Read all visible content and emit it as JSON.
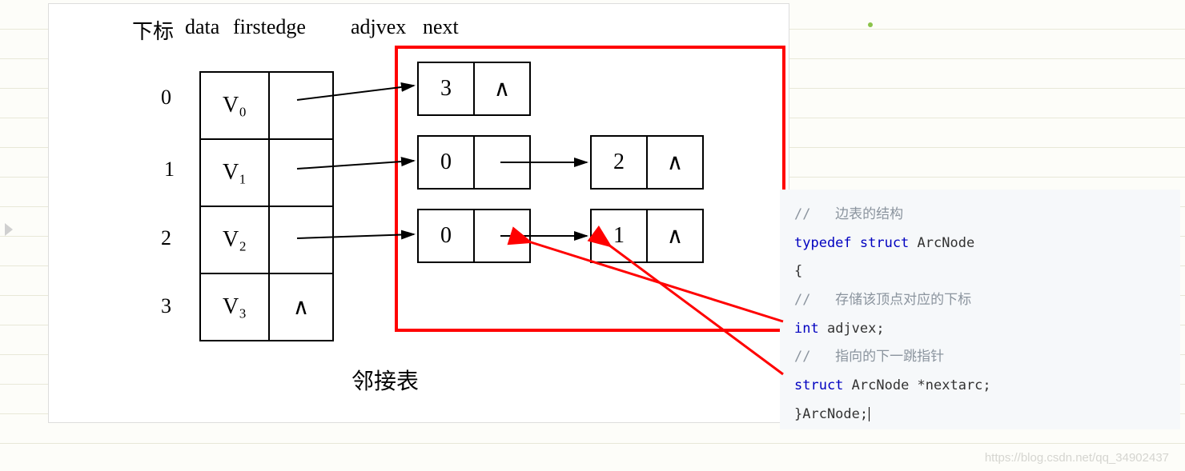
{
  "headers": {
    "subscript": "下标",
    "data": "data",
    "firstedge": "firstedge",
    "adjvex": "adjvex",
    "next": "next"
  },
  "indices": [
    "0",
    "1",
    "2",
    "3"
  ],
  "vertices": [
    "V₀",
    "V₁",
    "V₂",
    "V₃"
  ],
  "null_symbol": "∧",
  "edge_nodes": {
    "n00_adj": "3",
    "n10_adj": "0",
    "n11_adj": "2",
    "n20_adj": "0",
    "n21_adj": "1"
  },
  "caption": "邻接表",
  "code": {
    "l1_cmt": "//   边表的结构",
    "l2_kw": "typedef struct",
    "l2_name": " ArcNode",
    "l3": "{",
    "l4_cmt": "//   存储该顶点对应的下标",
    "l5_kw": "int",
    "l5_var": " adjvex;",
    "l6_cmt": "//   指向的下一跳指针",
    "l7_kw": "struct",
    "l7_rest": " ArcNode *nextarc;",
    "l8": "}ArcNode;"
  },
  "watermark": "https://blog.csdn.net/qq_34902437"
}
